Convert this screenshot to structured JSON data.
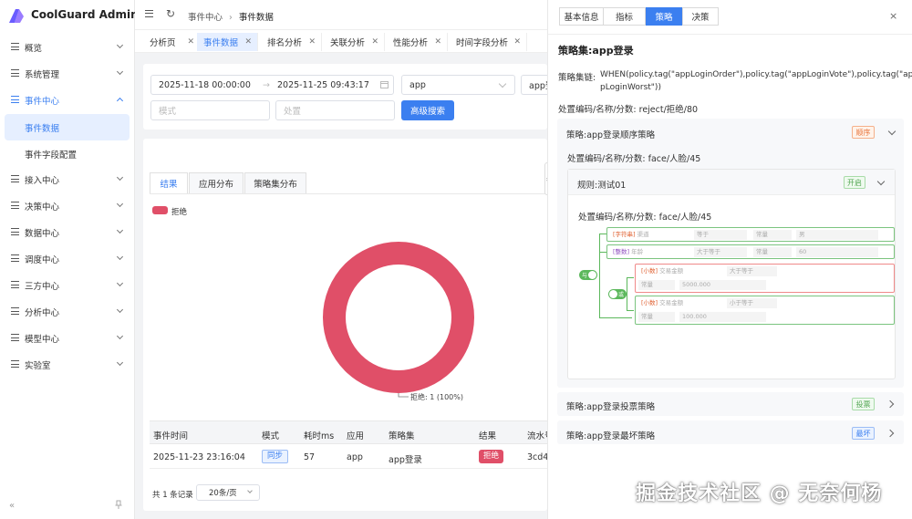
{
  "app": {
    "title": "CoolGuard Admin"
  },
  "sidebar": {
    "items": [
      {
        "label": "概览"
      },
      {
        "label": "系统管理"
      },
      {
        "label": "事件中心",
        "children": [
          "事件数据",
          "事件字段配置"
        ]
      },
      {
        "label": "接入中心"
      },
      {
        "label": "决策中心"
      },
      {
        "label": "数据中心"
      },
      {
        "label": "调度中心"
      },
      {
        "label": "三方中心"
      },
      {
        "label": "分析中心"
      },
      {
        "label": "模型中心"
      },
      {
        "label": "实验室"
      }
    ],
    "collapse_icon": "«",
    "pin_icon": "pin-icon"
  },
  "header": {
    "breadcrumb": [
      "事件中心",
      "事件数据"
    ]
  },
  "tabs": [
    "分析页",
    "事件数据",
    "排名分析",
    "关联分析",
    "性能分析",
    "时间字段分析"
  ],
  "filter": {
    "start": "2025-11-18 00:00:00",
    "end": "2025-11-25 09:43:17",
    "app": "app",
    "app2": "app登",
    "mode_placeholder": "模式",
    "handle_placeholder": "处置",
    "search_button": "高级搜索"
  },
  "result": {
    "tabs": [
      "结果",
      "应用分布",
      "策略集分布"
    ],
    "legend": "拒绝",
    "slice_label": "拒绝: 1 (100%)",
    "columns": [
      "事件时间",
      "模式",
      "耗时ms",
      "应用",
      "策略集",
      "结果",
      "流水号"
    ],
    "rows": [
      [
        "2025-11-23 23:16:04",
        "同步",
        "57",
        "app",
        "app登录",
        "拒绝",
        "3cd4"
      ]
    ],
    "total": "共 1 条记录",
    "page_size": "20条/页"
  },
  "chart_data": {
    "type": "pie",
    "categories": [
      "拒绝"
    ],
    "values": [
      1
    ],
    "colors": [
      "#e04f68"
    ]
  },
  "drawer": {
    "tabs": [
      "基本信息",
      "指标",
      "策略",
      "决策"
    ],
    "title": "策略集:app登录",
    "chain_label": "策略集链:",
    "chain_line1": "WHEN(policy.tag(\"appLoginOrder\"),policy.tag(\"appLoginVote\"),policy.tag(\"ap",
    "chain_line2": "pLoginWorst\"))",
    "handle": "处置编码/名称/分数: reject/拒绝/80",
    "policies": [
      {
        "title": "策略:app登录顺序策略",
        "badge": "顺序",
        "badge_color": "#e8743b"
      },
      {
        "title": "策略:app登录投票策略",
        "badge": "投票",
        "badge_color": "#52a552"
      },
      {
        "title": "策略:app登录最坏策略",
        "badge": "最坏",
        "badge_color": "#3b7ff0"
      }
    ],
    "policy1_handle": "处置编码/名称/分数: face/人脸/45",
    "rule": {
      "title": "规则:测试01",
      "badge": "开启",
      "handle": "处置编码/名称/分数: face/人脸/45",
      "and_label": "与",
      "or_label": "或",
      "conditions": [
        {
          "tag": "[字符串]",
          "field": "渠道",
          "op": "等于",
          "type": "常量",
          "value": "男"
        },
        {
          "tag": "[整数]",
          "field": "年龄",
          "op": "大于等于",
          "type": "常量",
          "value": "60"
        },
        {
          "tag": "[小数]",
          "field": "交易金额",
          "op": "大于等于",
          "type": "常量",
          "value": "5000.000"
        },
        {
          "tag": "[小数]",
          "field": "交易金额",
          "op": "小于等于",
          "type": "常量",
          "value": "100.000"
        }
      ]
    }
  },
  "watermark": "掘金技术社区 @ 无奈何杨"
}
